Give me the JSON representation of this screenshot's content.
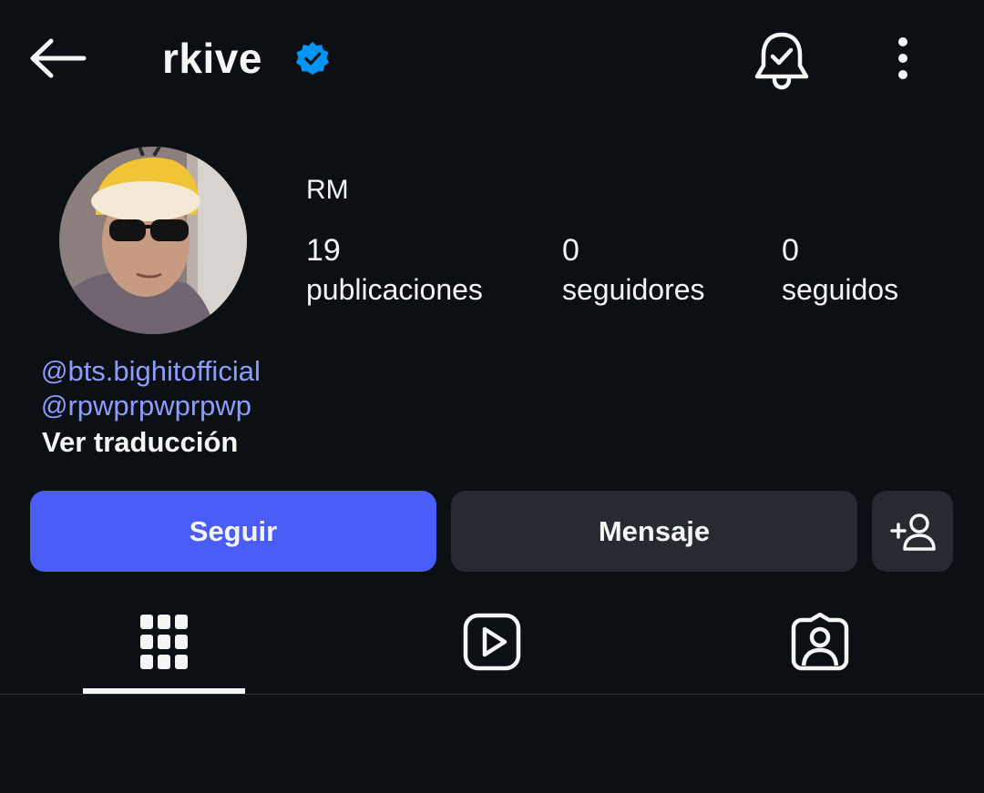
{
  "header": {
    "username": "rkive",
    "back_icon": "arrow-left-icon",
    "verified_icon": "verified-badge-icon",
    "notification_icon": "bell-check-icon",
    "more_icon": "more-vertical-icon"
  },
  "profile": {
    "display_name": "RM",
    "stats": {
      "posts": {
        "count": "19",
        "label": "publicaciones"
      },
      "followers": {
        "count": "0",
        "label": "seguidores"
      },
      "following": {
        "count": "0",
        "label": "seguidos"
      }
    },
    "bio_links": [
      {
        "icon": "threads-icon",
        "text": "bts.bighitofficial"
      },
      {
        "icon": "threads-icon",
        "text": "rpwprpwprpwp"
      }
    ],
    "translate_label": "Ver traducción"
  },
  "actions": {
    "follow_label": "Seguir",
    "message_label": "Mensaje",
    "add_user_icon": "add-user-icon"
  },
  "tabs": [
    {
      "name": "grid",
      "icon": "grid-icon",
      "active": true
    },
    {
      "name": "reels",
      "icon": "reels-icon",
      "active": false
    },
    {
      "name": "tagged",
      "icon": "tagged-user-icon",
      "active": false
    }
  ],
  "colors": {
    "background": "#0c1014",
    "accent": "#4a5df9",
    "link": "#8c9cff",
    "verified": "#0095f6",
    "secondary_button": "#262a31"
  }
}
